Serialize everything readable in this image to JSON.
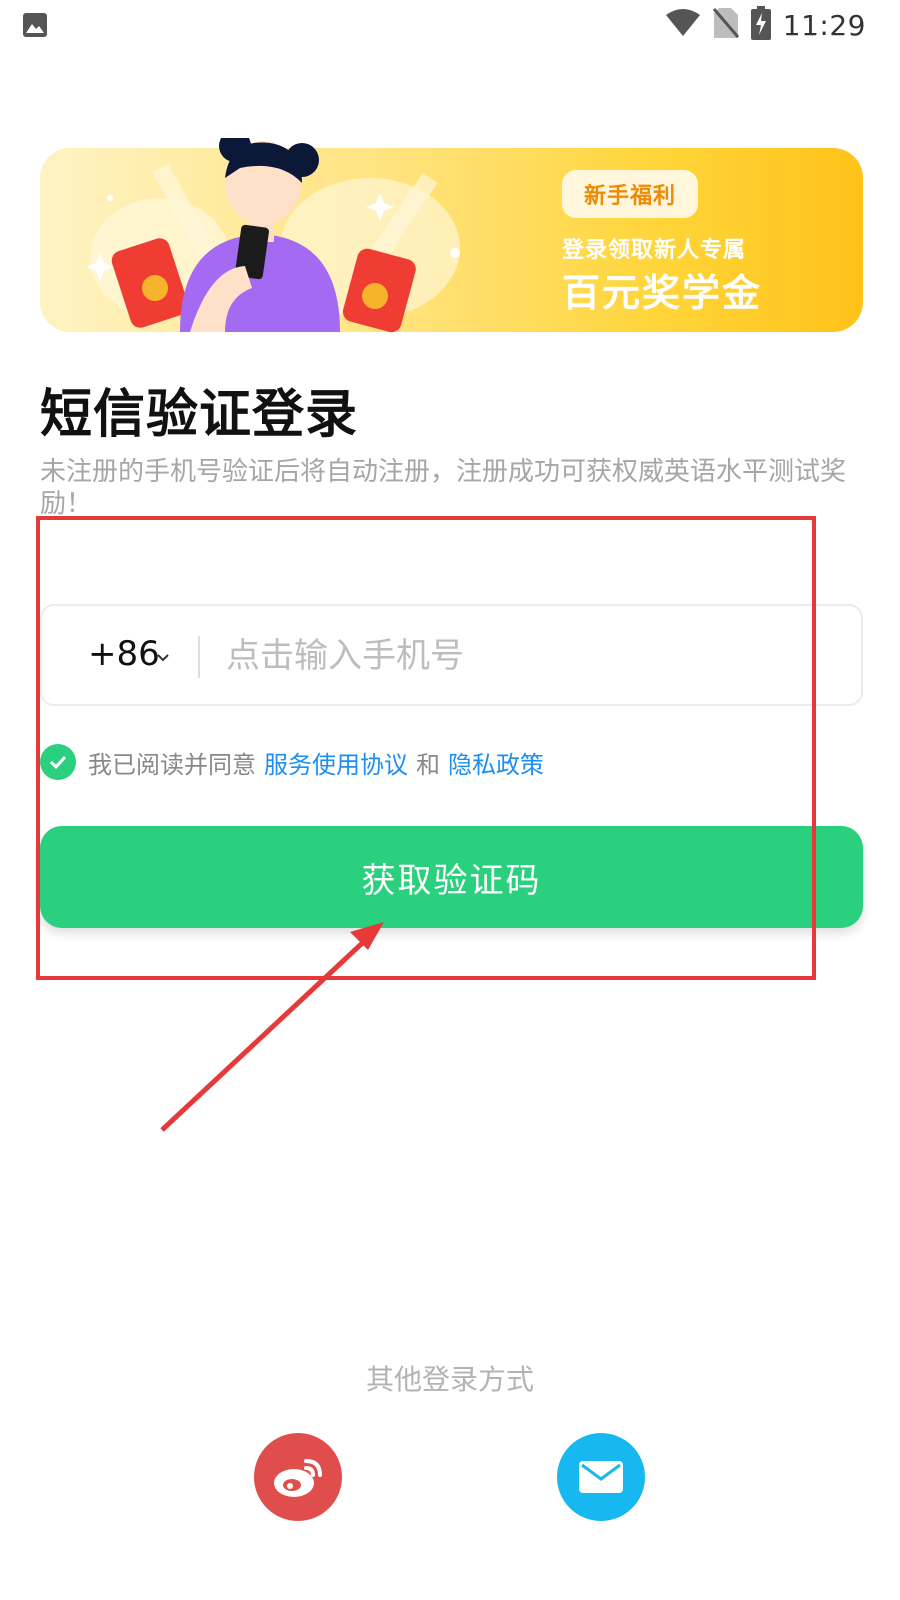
{
  "status_bar": {
    "time": "11:29",
    "icons": [
      "gallery-icon",
      "wifi-icon",
      "no-sim-icon",
      "battery-charging-icon"
    ]
  },
  "banner": {
    "badge": "新手福利",
    "line1": "登录领取新人专属",
    "line2": "百元奖学金"
  },
  "login": {
    "title": "短信验证登录",
    "description": "未注册的手机号验证后将自动注册，注册成功可获权威英语水平测试奖励！",
    "country_code": "+86",
    "phone_placeholder": "点击输入手机号",
    "phone_value": "",
    "agreement": {
      "prefix": "我已阅读并同意",
      "terms_link": "服务使用协议",
      "conjunction": "和",
      "privacy_link": "隐私政策",
      "checked": true
    },
    "submit_label": "获取验证码"
  },
  "other_login": {
    "title": "其他登录方式",
    "methods": [
      {
        "name": "weibo",
        "icon": "weibo-icon",
        "color": "#e04d4d"
      },
      {
        "name": "email",
        "icon": "mail-icon",
        "color": "#17b8f0"
      }
    ]
  },
  "colors": {
    "primary_green": "#2ad07e",
    "link_blue": "#1f8ef1",
    "annotation_red": "#e53a3a"
  }
}
